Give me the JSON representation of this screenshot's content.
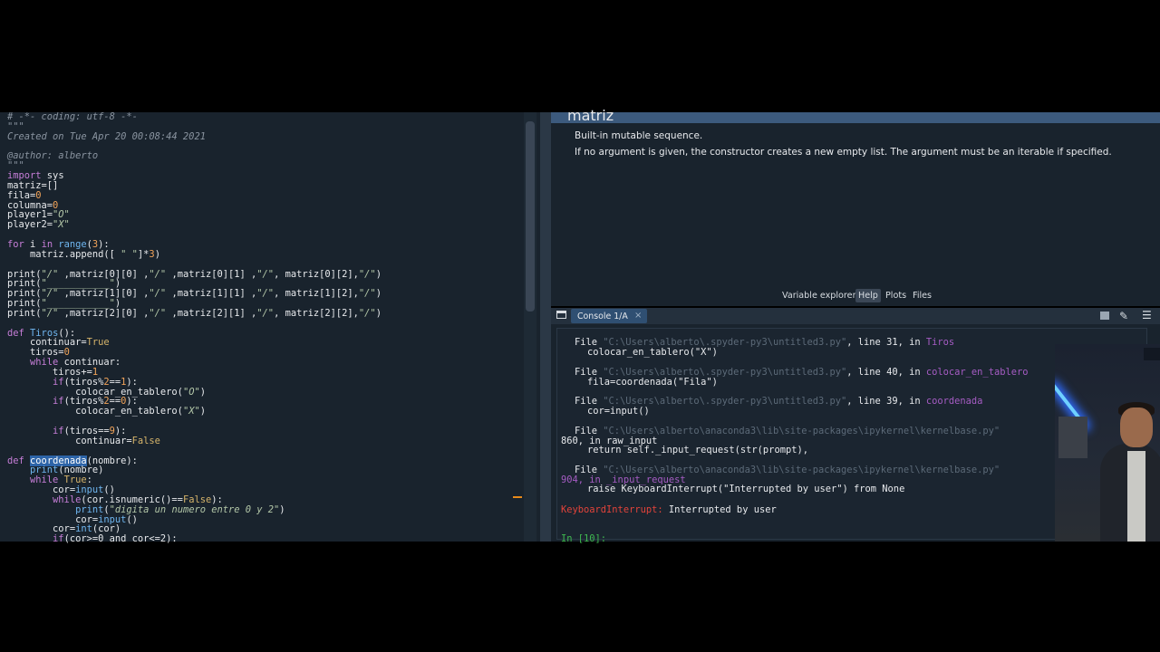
{
  "editor": {
    "lines": [
      [
        [
          "c-com",
          "# -*- coding: utf-8 -*-"
        ]
      ],
      [
        [
          "c-com",
          "\"\"\""
        ]
      ],
      [
        [
          "c-com",
          "Created on Tue Apr 20 00:08:44 2021"
        ]
      ],
      [
        [
          "",
          ""
        ]
      ],
      [
        [
          "c-com",
          "@author: alberto"
        ]
      ],
      [
        [
          "c-com",
          "\"\"\""
        ]
      ],
      [
        [
          "c-kw",
          "import"
        ],
        [
          "",
          " sys"
        ]
      ],
      [
        [
          "",
          "matriz=[]"
        ]
      ],
      [
        [
          "",
          "fila="
        ],
        [
          "c-num",
          "0"
        ]
      ],
      [
        [
          "",
          "columna="
        ],
        [
          "c-num",
          "0"
        ]
      ],
      [
        [
          "",
          "player1="
        ],
        [
          "c-str",
          "\"O\""
        ]
      ],
      [
        [
          "",
          "player2="
        ],
        [
          "c-str",
          "\"X\""
        ]
      ],
      [
        [
          "",
          ""
        ]
      ],
      [
        [
          "c-kw",
          "for"
        ],
        [
          "",
          " i "
        ],
        [
          "c-kw",
          "in"
        ],
        [
          "",
          " "
        ],
        [
          "c-fn",
          "range"
        ],
        [
          "",
          "("
        ],
        [
          "c-num",
          "3"
        ],
        [
          "",
          "):"
        ]
      ],
      [
        [
          "",
          "    matriz.append([ "
        ],
        [
          "c-str",
          "\" \""
        ],
        [
          "",
          "]*"
        ],
        [
          "c-num",
          "3"
        ],
        [
          "",
          ")"
        ]
      ],
      [
        [
          "",
          ""
        ]
      ],
      [
        [
          "",
          "print("
        ],
        [
          "c-str",
          "\"/\""
        ],
        [
          "",
          " ,matriz[0][0] ,"
        ],
        [
          "c-str",
          "\"/\""
        ],
        [
          "",
          " ,matriz[0][1] ,"
        ],
        [
          "c-str",
          "\"/\""
        ],
        [
          "",
          ", matriz[0][2],"
        ],
        [
          "c-str",
          "\"/\""
        ],
        [
          "",
          ")"
        ]
      ],
      [
        [
          "",
          "print("
        ],
        [
          "c-str",
          "\"___________\""
        ],
        [
          "",
          ")"
        ]
      ],
      [
        [
          "",
          "print("
        ],
        [
          "c-str",
          "\"/\""
        ],
        [
          "",
          " ,matriz[1][0] ,"
        ],
        [
          "c-str",
          "\"/\""
        ],
        [
          "",
          " ,matriz[1][1] ,"
        ],
        [
          "c-str",
          "\"/\""
        ],
        [
          "",
          ", matriz[1][2],"
        ],
        [
          "c-str",
          "\"/\""
        ],
        [
          "",
          ")"
        ]
      ],
      [
        [
          "",
          "print("
        ],
        [
          "c-str",
          "\"___________\""
        ],
        [
          "",
          ")"
        ]
      ],
      [
        [
          "",
          "print("
        ],
        [
          "c-str",
          "\"/\""
        ],
        [
          "",
          " ,matriz[2][0] ,"
        ],
        [
          "c-str",
          "\"/\""
        ],
        [
          "",
          " ,matriz[2][1] ,"
        ],
        [
          "c-str",
          "\"/\""
        ],
        [
          "",
          ", matriz[2][2],"
        ],
        [
          "c-str",
          "\"/\""
        ],
        [
          "",
          ")"
        ]
      ],
      [
        [
          "",
          ""
        ]
      ],
      [
        [
          "c-kw",
          "def"
        ],
        [
          "",
          " "
        ],
        [
          "c-fn",
          "Tiros"
        ],
        [
          "",
          "():"
        ]
      ],
      [
        [
          "",
          "    continuar="
        ],
        [
          "c-self",
          "True"
        ]
      ],
      [
        [
          "",
          "    tiros="
        ],
        [
          "c-num",
          "0"
        ]
      ],
      [
        [
          "",
          "    "
        ],
        [
          "c-kw",
          "while"
        ],
        [
          "",
          " continuar:"
        ]
      ],
      [
        [
          "",
          "        tiros+="
        ],
        [
          "c-num",
          "1"
        ]
      ],
      [
        [
          "",
          "        "
        ],
        [
          "c-kw",
          "if"
        ],
        [
          "",
          "(tiros%"
        ],
        [
          "c-num",
          "2"
        ],
        [
          "",
          "=="
        ],
        [
          "c-num",
          "1"
        ],
        [
          "",
          "):"
        ]
      ],
      [
        [
          "",
          "            colocar_en_tablero("
        ],
        [
          "c-str",
          "\"O\""
        ],
        [
          "",
          ")"
        ]
      ],
      [
        [
          "",
          "        "
        ],
        [
          "c-kw",
          "if"
        ],
        [
          "",
          "(tiros%"
        ],
        [
          "c-num",
          "2"
        ],
        [
          "",
          "=="
        ],
        [
          "c-num",
          "0"
        ],
        [
          "",
          "):"
        ]
      ],
      [
        [
          "",
          "            colocar_en_tablero("
        ],
        [
          "c-str",
          "\"X\""
        ],
        [
          "",
          ")"
        ]
      ],
      [
        [
          "",
          ""
        ]
      ],
      [
        [
          "",
          "        "
        ],
        [
          "c-kw",
          "if"
        ],
        [
          "",
          "(tiros=="
        ],
        [
          "c-num",
          "9"
        ],
        [
          "",
          "):"
        ]
      ],
      [
        [
          "",
          "            continuar="
        ],
        [
          "c-self",
          "False"
        ]
      ],
      [
        [
          "",
          ""
        ]
      ],
      [
        [
          "c-kw",
          "def"
        ],
        [
          "",
          " "
        ],
        [
          "hl",
          "coordenada"
        ],
        [
          "",
          "(nombre):"
        ]
      ],
      [
        [
          "",
          "    "
        ],
        [
          "c-fn",
          "print"
        ],
        [
          "",
          "(nombre)"
        ]
      ],
      [
        [
          "",
          "    "
        ],
        [
          "c-kw",
          "while"
        ],
        [
          "",
          " "
        ],
        [
          "c-self",
          "True"
        ],
        [
          "",
          ":"
        ]
      ],
      [
        [
          "",
          "        cor="
        ],
        [
          "c-fn",
          "input"
        ],
        [
          "",
          "()"
        ]
      ],
      [
        [
          "",
          "        "
        ],
        [
          "c-kw",
          "while"
        ],
        [
          "",
          "(cor.isnumeric()=="
        ],
        [
          "c-self",
          "False"
        ],
        [
          "",
          "):"
        ]
      ],
      [
        [
          "",
          "            "
        ],
        [
          "c-fn",
          "print"
        ],
        [
          "",
          "("
        ],
        [
          "c-str",
          "\"digita un numero entre 0 y 2\""
        ],
        [
          "",
          ")"
        ]
      ],
      [
        [
          "",
          "            cor="
        ],
        [
          "c-fn",
          "input"
        ],
        [
          "",
          "()"
        ]
      ],
      [
        [
          "",
          "        cor="
        ],
        [
          "c-fn",
          "int"
        ],
        [
          "",
          "(cor)"
        ]
      ],
      [
        [
          "",
          "        "
        ],
        [
          "c-kw",
          "if"
        ],
        [
          "",
          "(cor>=0 and cor<=2):"
        ]
      ]
    ]
  },
  "help": {
    "title": "matriz",
    "p1": "Built-in mutable sequence.",
    "p2": "If no argument is given, the constructor creates a new empty list. The argument must be an iterable if specified."
  },
  "pane_tabs": {
    "variable_explorer": "Variable explorer",
    "help": "Help",
    "plots": "Plots",
    "files": "Files"
  },
  "console": {
    "tab_label": "Console 1/A",
    "close": "×",
    "traceback": [
      {
        "file": "File ",
        "path": "\"C:\\Users\\alberto\\.spyder-py3\\untitled3.py\"",
        "rest": ", line 31, in ",
        "fn": "Tiros",
        "code": "colocar_en_tablero(\"X\")"
      },
      {
        "file": "File ",
        "path": "\"C:\\Users\\alberto\\.spyder-py3\\untitled3.py\"",
        "rest": ", line 40, in ",
        "fn": "colocar_en_tablero",
        "code": "fila=coordenada(\"Fila\")"
      },
      {
        "file": "File ",
        "path": "\"C:\\Users\\alberto\\.spyder-py3\\untitled3.py\"",
        "rest": ", line 39, in ",
        "fn": "coordenada",
        "code": "cor=input()"
      },
      {
        "file": "File ",
        "path": "\"C:\\Users\\alberto\\anaconda3\\lib\\site-packages\\ipykernel\\kernelbase.py\"",
        "rest": "",
        "fn": "",
        "code": "return self._input_request(str(prompt),"
      },
      {
        "file": "File ",
        "path": "\"C:\\Users\\alberto\\anaconda3\\lib\\site-packages\\ipykernel\\kernelbase.py\"",
        "rest": "",
        "fn": "",
        "code": "raise KeyboardInterrupt(\"Interrupted by user\") from None"
      }
    ],
    "line860": "860, in raw_input",
    "line904": "904, in _input_request",
    "error_name": "KeyboardInterrupt:",
    "error_msg": " Interrupted by user",
    "prompt": "In [10]:"
  },
  "colors": {
    "editor_bg": "#19232d",
    "accent": "#2f4f72",
    "error": "#e2433a",
    "marker": "#e88a1a"
  }
}
